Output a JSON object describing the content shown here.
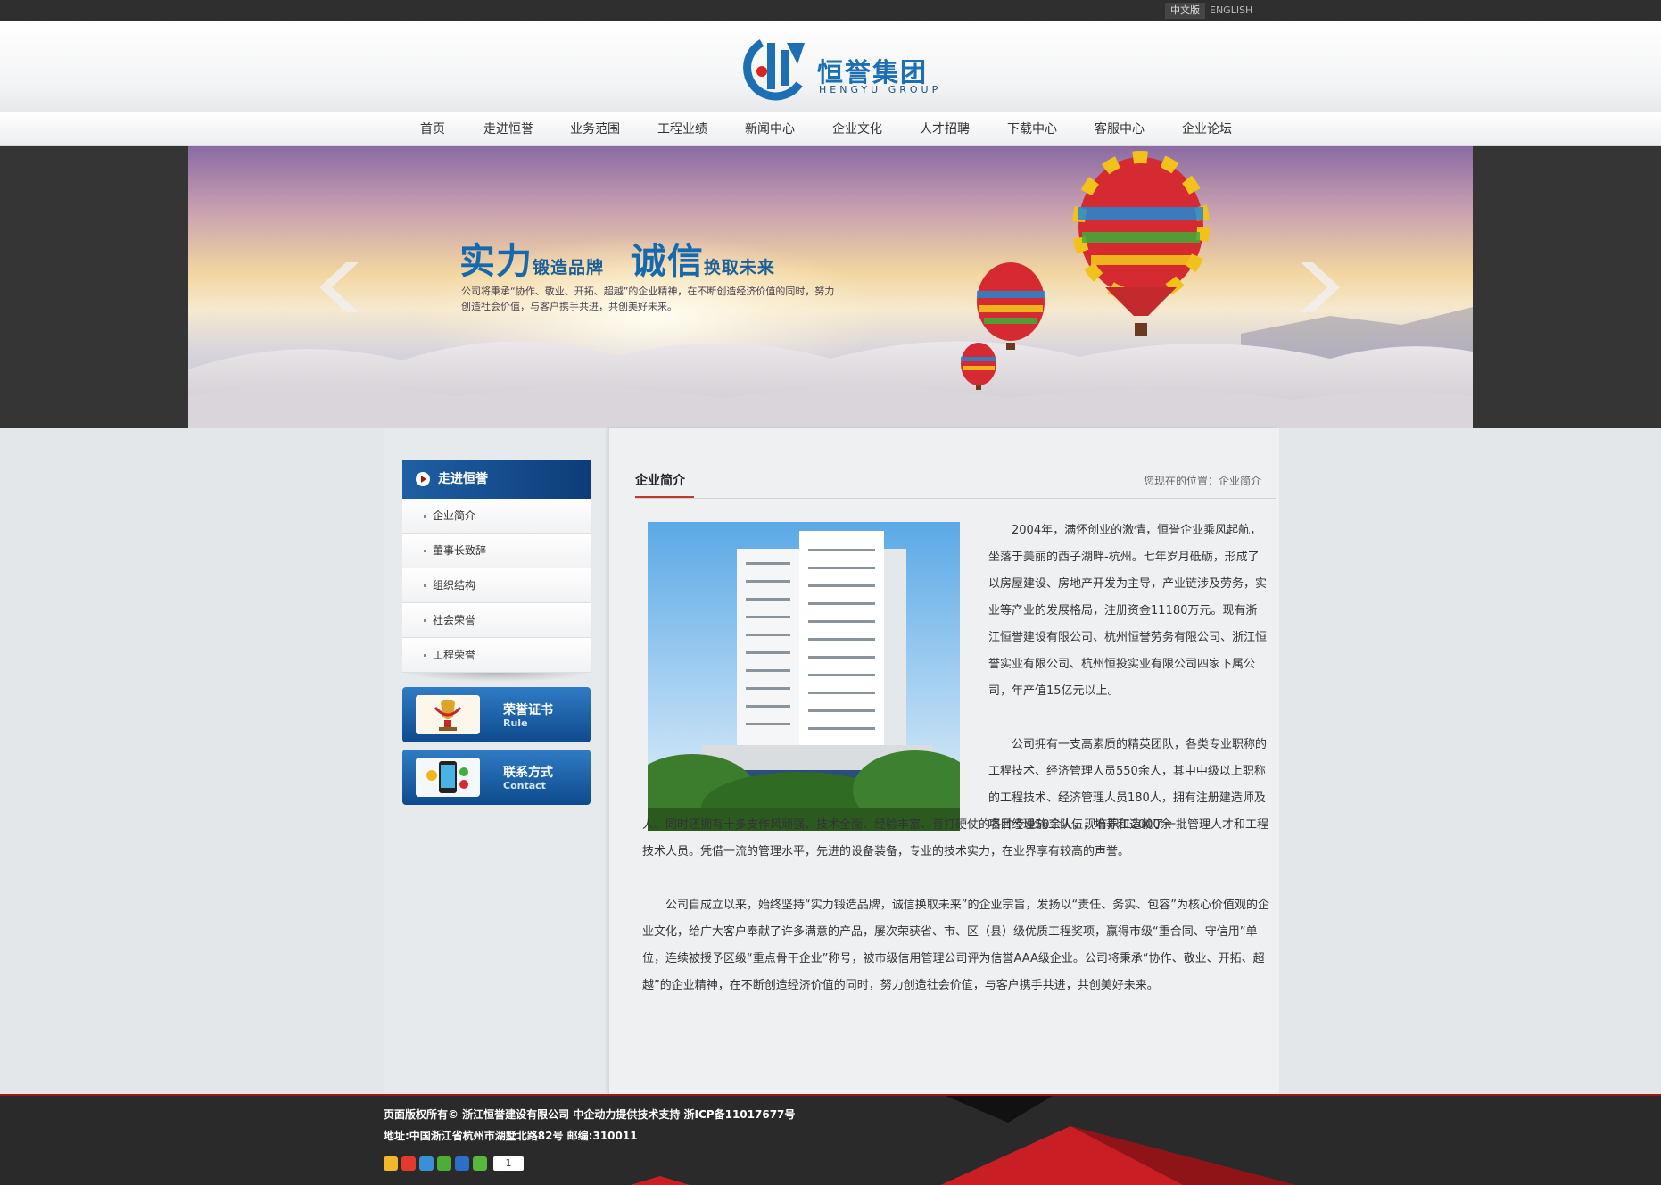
{
  "lang": {
    "zh": "中文版",
    "en": "ENGLISH"
  },
  "brand": {
    "name": "恒誉集团",
    "sub": "HENGYU GROUP",
    "color": "#1d6fb3"
  },
  "nav": [
    {
      "label": "首页"
    },
    {
      "label": "走进恒誉"
    },
    {
      "label": "业务范围"
    },
    {
      "label": "工程业绩"
    },
    {
      "label": "新闻中心"
    },
    {
      "label": "企业文化"
    },
    {
      "label": "人才招聘"
    },
    {
      "label": "下载中心"
    },
    {
      "label": "客服中心"
    },
    {
      "label": "企业论坛"
    }
  ],
  "banner": {
    "t1": "实力",
    "t2": "锻造品牌",
    "t3": "诚信",
    "t4": "换取未来",
    "text": "公司将秉承“协作、敬业、开拓、超越”的企业精神，在不断创造经济价值的同时，努力创造社会价值，与客户携手共进，共创美好未来。"
  },
  "sidebar": {
    "title": "走进恒誉",
    "items": [
      {
        "label": "企业简介"
      },
      {
        "label": "董事长致辞"
      },
      {
        "label": "组织结构"
      },
      {
        "label": "社会荣誉"
      },
      {
        "label": "工程荣誉"
      }
    ],
    "boxes": {
      "rule": {
        "title": "荣誉证书",
        "sub": "Rule"
      },
      "contact": {
        "title": "联系方式",
        "sub": "Contact"
      }
    }
  },
  "content": {
    "title": "企业简介",
    "breadcrumb": "您现在的位置：企业简介",
    "p1": "2004年，满怀创业的激情，恒誉企业乘风起航，坐落于美丽的西子湖畔-杭州。七年岁月砥砺，形成了以房屋建设、房地产开发为主导，产业链涉及劳务，实业等产业的发展格局，注册资金11180万元。现有浙江恒誉建设有限公司、杭州恒誉劳务有限公司、浙江恒誉实业有限公司、杭州恒投实业有限公司四家下属公司，年产值15亿元以上。",
    "p2": "公司拥有一支高素质的精英团队，各类专业职称的工程技术、经济管理人员550余人，其中中级以上职称的工程技术、经济管理人员180人，拥有注册建造师及项目经理50余人，现有职工2000余",
    "p3": "人。同时还拥有十多支作风顽强、技术全面、经验丰富、善打硬仗的各种专业施工队伍，培养和造就了一批管理人才和工程技术人员。凭借一流的管理水平，先进的设备装备，专业的技术实力，在业界享有较高的声誉。",
    "p4": "公司自成立以来，始终坚持“实力锻造品牌，诚信换取未来”的企业宗旨，发扬以“责任、务实、包容”为核心价值观的企业文化，给广大客户奉献了许多满意的产品，屡次荣获省、市、区（县）级优质工程奖项，赢得市级“重合同、守信用”单位，连续被授予区级“重点骨干企业”称号，被市级信用管理公司评为信誉AAA级企业。公司将秉承“协作、敬业、开拓、超越”的企业精神，在不断创造经济价值的同时，努力创造社会价值，与客户携手共进，共创美好未来。"
  },
  "footer": {
    "line1": "页面版权所有© 浙江恒誉建设有限公司 中企动力提供技术支持 浙ICP备11017677号",
    "line2": "地址:中国浙江省杭州市湖墅北路82号 邮编:310011",
    "share_count": "1"
  }
}
